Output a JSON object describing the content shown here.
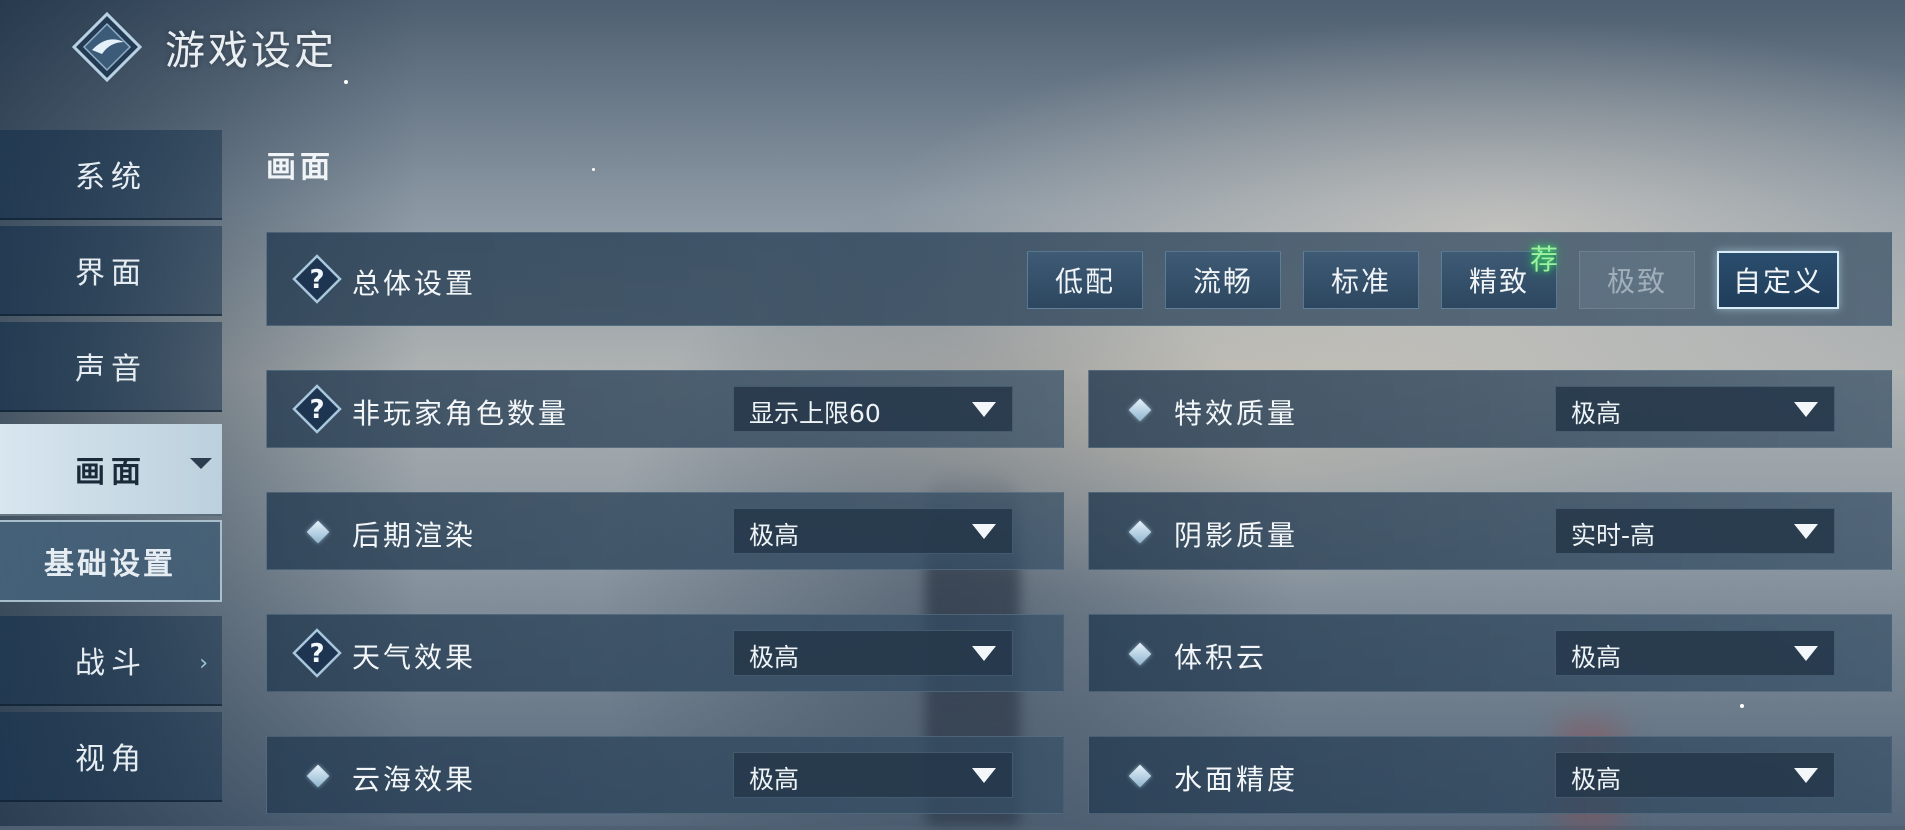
{
  "header": {
    "title": "游戏设定",
    "logo_icon": "game-emblem-icon"
  },
  "sidebar": {
    "items": [
      {
        "label": "系统"
      },
      {
        "label": "界面"
      },
      {
        "label": "声音"
      },
      {
        "label": "画面",
        "active": true
      },
      {
        "label": "基础设置",
        "sub": true
      },
      {
        "label": "战斗"
      },
      {
        "label": "视角"
      }
    ]
  },
  "section": {
    "title": "画面"
  },
  "overall": {
    "label": "总体设置",
    "presets": [
      "低配",
      "流畅",
      "标准",
      "精致",
      "极致",
      "自定义"
    ],
    "disabled_preset": "极致",
    "selected_preset": "自定义",
    "recommended_badge": "荐"
  },
  "settings": {
    "left": [
      {
        "label": "非玩家角色数量",
        "value": "显示上限60",
        "help": true
      },
      {
        "label": "后期渲染",
        "value": "极高",
        "help": false
      },
      {
        "label": "天气效果",
        "value": "极高",
        "help": true
      },
      {
        "label": "云海效果",
        "value": "极高",
        "help": false
      }
    ],
    "right": [
      {
        "label": "特效质量",
        "value": "极高"
      },
      {
        "label": "阴影质量",
        "value": "实时-高"
      },
      {
        "label": "体积云",
        "value": "极高"
      },
      {
        "label": "水面精度",
        "value": "极高"
      }
    ]
  },
  "colors": {
    "accent": "#d9ecf8",
    "panel": "#2d4760",
    "recommended": "#9ff0a0"
  }
}
